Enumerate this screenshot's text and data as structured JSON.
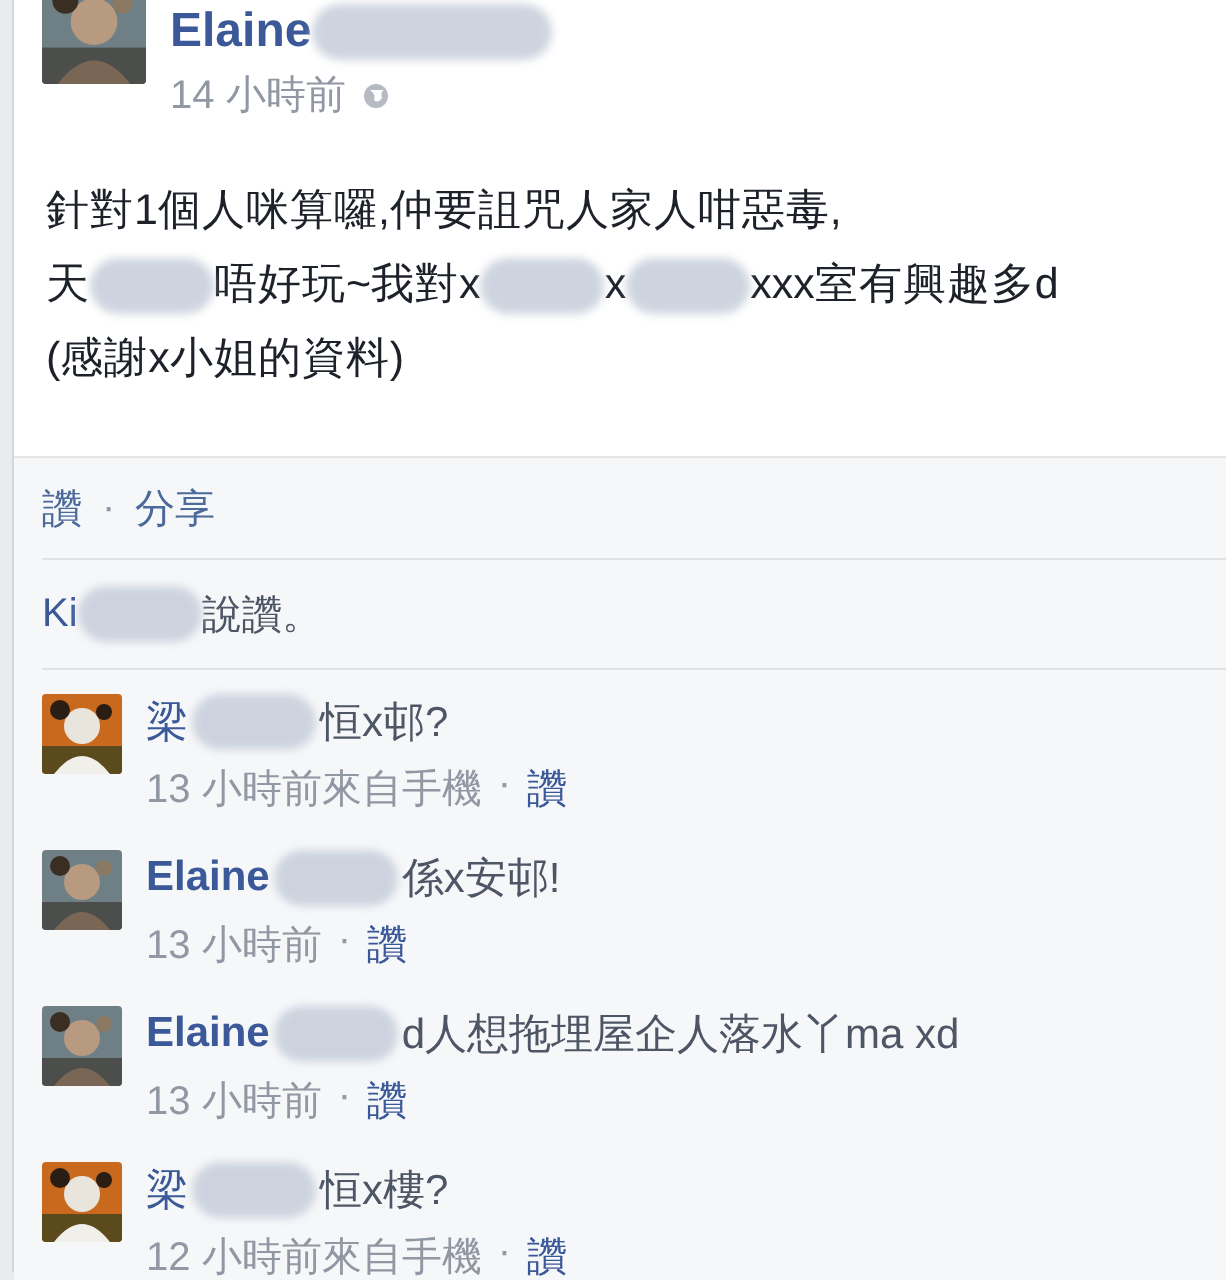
{
  "post": {
    "author": [
      {
        "kind": "name",
        "text": "Elaine"
      },
      {
        "kind": "blur"
      }
    ],
    "time": "14 小時前",
    "lines": [
      [
        {
          "kind": "text",
          "text": "針對1個人咪算囉,仲要詛咒人家人咁惡毒,"
        }
      ],
      [
        {
          "kind": "text",
          "text": "天"
        },
        {
          "kind": "blur"
        },
        {
          "kind": "text",
          "text": "唔好玩~我對x"
        },
        {
          "kind": "blur"
        },
        {
          "kind": "text",
          "text": "x"
        },
        {
          "kind": "blur"
        },
        {
          "kind": "text",
          "text": "xxx室有興趣多d"
        }
      ],
      [
        {
          "kind": "text",
          "text": "(感謝x小姐的資料)"
        }
      ]
    ]
  },
  "actions": [
    {
      "label": "讚"
    },
    {
      "label": "分享"
    }
  ],
  "separator": "·",
  "likes": [
    {
      "kind": "name",
      "text": "Ki"
    },
    {
      "kind": "blur"
    },
    {
      "kind": "text",
      "text": "說讚。"
    }
  ],
  "comments": [
    {
      "line": [
        {
          "kind": "name",
          "text": "梁"
        },
        {
          "kind": "blur"
        },
        {
          "kind": "text",
          "text": "恒x邨?"
        }
      ],
      "time": "13 小時前來自手機",
      "like": "讚"
    },
    {
      "line": [
        {
          "kind": "name",
          "text": "Elaine",
          "bold": true
        },
        {
          "kind": "blur"
        },
        {
          "kind": "text",
          "text": "係x安邨!"
        }
      ],
      "time": "13 小時前",
      "like": "讚"
    },
    {
      "line": [
        {
          "kind": "name",
          "text": "Elaine",
          "bold": true
        },
        {
          "kind": "blur"
        },
        {
          "kind": "text",
          "text": "d人想拖埋屋企人落水丫ma xd"
        }
      ],
      "time": "13 小時前",
      "like": "讚"
    },
    {
      "line": [
        {
          "kind": "name",
          "text": "梁"
        },
        {
          "kind": "blur"
        },
        {
          "kind": "text",
          "text": "恒x樓?"
        }
      ],
      "time": "12 小時前來自手機",
      "like": "讚"
    }
  ]
}
